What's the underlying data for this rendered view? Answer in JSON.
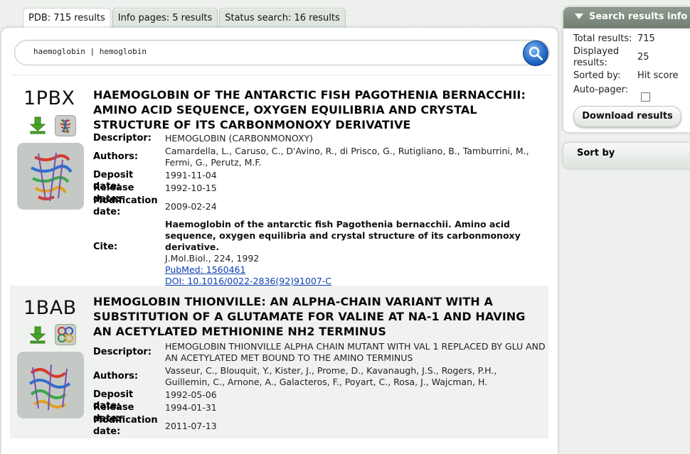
{
  "tabs": [
    {
      "label": "PDB: 715 results"
    },
    {
      "label": "Info pages: 5 results"
    },
    {
      "label": "Status search: 16 results"
    }
  ],
  "search": {
    "value": "haemoglobin | hemoglobin"
  },
  "labels": {
    "descriptor": "Descriptor:",
    "authors": "Authors:",
    "deposit": "Deposit date:",
    "release": "Release date:",
    "modification": "Modification date:",
    "cite": "Cite:"
  },
  "entries": [
    {
      "id": "1PBX",
      "title": "HAEMOGLOBIN OF THE ANTARCTIC FISH PAGOTHENIA BERNACCHII: AMINO ACID SEQUENCE, OXYGEN EQUILIBRIA AND CRYSTAL STRUCTURE OF ITS CARBONMONOXY DERIVATIVE",
      "descriptor": "HEMOGLOBIN (CARBONMONOXY)",
      "authors": "Camardella, L., Caruso, C., D'Avino, R., di Prisco, G., Rutigliano, B., Tamburrini, M., Fermi, G., Perutz, M.F.",
      "deposit_date": "1991-11-04",
      "release_date": "1992-10-15",
      "modification_date": "2009-02-24",
      "cite_title": "Haemoglobin of the antarctic fish Pagothenia bernacchii. Amino acid sequence, oxygen equilibria and crystal structure of its carbonmonoxy derivative.",
      "cite_journal": "J.Mol.Biol., 224, 1992",
      "pubmed": "PubMed: 1560461",
      "doi": "DOI: 10.1016/0022-2836(92)91007-C"
    },
    {
      "id": "1BAB",
      "title": "HEMOGLOBIN THIONVILLE: AN ALPHA-CHAIN VARIANT WITH A SUBSTITUTION OF A GLUTAMATE FOR VALINE AT NA-1 AND HAVING AN ACETYLATED METHIONINE NH2 TERMINUS",
      "descriptor": "HEMOGLOBIN THIONVILLE ALPHA CHAIN MUTANT WITH VAL 1 REPLACED BY GLU AND AN ACETYLATED MET BOUND TO THE AMINO TERMINUS",
      "authors": "Vasseur, C., Blouquit, Y., Kister, J., Prome, D., Kavanaugh, J.S., Rogers, P.H., Guillemin, C., Arnone, A., Galacteros, F., Poyart, C., Rosa, J., Wajcman, H.",
      "deposit_date": "1992-05-06",
      "release_date": "1994-01-31",
      "modification_date": "2011-07-13"
    }
  ],
  "sidebar": {
    "info_title": "Search results info",
    "total_label": "Total results:",
    "total_value": "715",
    "displayed_label": "Displayed results:",
    "displayed_value": "25",
    "sorted_label": "Sorted by:",
    "sorted_value": "Hit score",
    "autopager_label": "Auto-pager:",
    "autopager_checked": false,
    "download_label": "Download results",
    "sortby_title": "Sort by"
  },
  "colors": {
    "accent_link": "#0b3fb5",
    "search_button": "#1f63c6",
    "header_gray": "#7f8c7f"
  },
  "icons": {
    "search": "magnifier-icon",
    "download": "download-arrow-icon",
    "chevron": "triangle-down-icon"
  }
}
